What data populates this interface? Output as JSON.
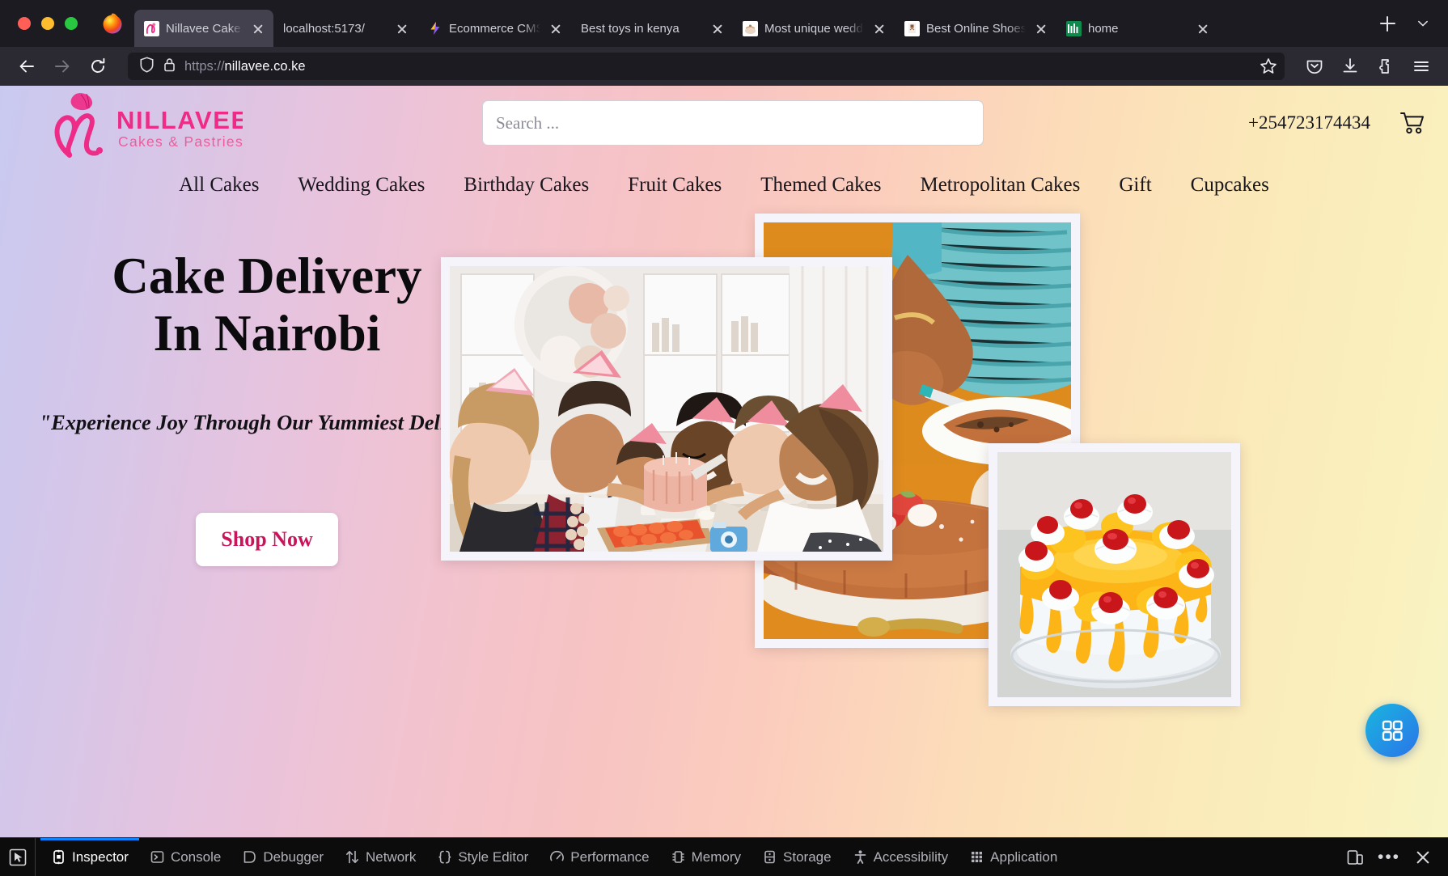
{
  "browser": {
    "window_controls": [
      "close",
      "minimize",
      "maximize"
    ],
    "app_icon": "firefox-icon",
    "tabs": [
      {
        "title": "Nillavee Cake Shop",
        "favicon": "nillavee-logo-icon",
        "active": true
      },
      {
        "title": "localhost:5173/",
        "favicon": "",
        "active": false
      },
      {
        "title": "Ecommerce CMS",
        "favicon": "lightning-icon",
        "active": false
      },
      {
        "title": "Best toys in kenya",
        "favicon": "",
        "active": false
      },
      {
        "title": "Most unique wedding cakes",
        "favicon": "cake-thumb-icon",
        "active": false
      },
      {
        "title": "Best Online Shoes",
        "favicon": "shoe-thumb-icon",
        "active": false
      },
      {
        "title": "home",
        "favicon": "green-sheet-icon",
        "active": false
      }
    ],
    "new_tab_label": "+",
    "list_all_tabs_label": "List all tabs",
    "back_label": "Go back",
    "forward_label": "Go forward",
    "reload_label": "Reload",
    "url_scheme": "https://",
    "url_host": "nillavee.co.ke",
    "bookmark_label": "Bookmark this page",
    "toolbar_right": [
      "pocket-icon",
      "downloads-icon",
      "extensions-icon",
      "app-menu-icon"
    ]
  },
  "site": {
    "logo": {
      "brand": "NILLAVEE",
      "tagline": "Cakes & Pastries",
      "monogram": "N",
      "color": "#ed1e79"
    },
    "search": {
      "value": "",
      "placeholder": "Search ..."
    },
    "contact": {
      "phone": "+254723174434"
    },
    "cart": {
      "icon": "shopping-cart-icon",
      "count": ""
    },
    "nav": [
      {
        "label": "All Cakes"
      },
      {
        "label": "Wedding Cakes"
      },
      {
        "label": "Birthday Cakes"
      },
      {
        "label": "Fruit Cakes"
      },
      {
        "label": "Themed Cakes"
      },
      {
        "label": "Metropolitan Cakes"
      },
      {
        "label": "Gift"
      },
      {
        "label": "Cupcakes"
      }
    ],
    "hero": {
      "title": "Cake Delivery In Nairobi",
      "subtitle": "\"Experience Joy Through Our Yummiest Delights\"",
      "cta_label": "Shop Now",
      "cta_text_color": "#c9145b",
      "images": [
        {
          "name": "birthday-party-cake-photo",
          "alt": "Friends in party hats cutting a pink birthday cake"
        },
        {
          "name": "chocolate-cake-serving-photo",
          "alt": "Woman slicing a chocolate mousse cake on an orange background"
        },
        {
          "name": "mango-cream-cake-photo",
          "alt": "Mango glazed cake with cherries and cream swirls"
        }
      ]
    },
    "fab": {
      "icon": "apps-grid-icon",
      "label": "Open widget panel",
      "color_from": "#19b6e0",
      "color_to": "#2b74e8"
    },
    "background_gradient": [
      "#c9c9f0",
      "#f2c3cf",
      "#fbcdbd",
      "#faf0bd"
    ]
  },
  "devtools": {
    "picker_icon": "element-picker-icon",
    "tabs": [
      {
        "label": "Inspector",
        "icon": "inspector-icon",
        "active": true
      },
      {
        "label": "Console",
        "icon": "console-icon",
        "active": false
      },
      {
        "label": "Debugger",
        "icon": "debugger-icon",
        "active": false
      },
      {
        "label": "Network",
        "icon": "network-icon",
        "active": false
      },
      {
        "label": "Style Editor",
        "icon": "style-editor-icon",
        "active": false
      },
      {
        "label": "Performance",
        "icon": "performance-icon",
        "active": false
      },
      {
        "label": "Memory",
        "icon": "memory-icon",
        "active": false
      },
      {
        "label": "Storage",
        "icon": "storage-icon",
        "active": false
      },
      {
        "label": "Accessibility",
        "icon": "accessibility-icon",
        "active": false
      },
      {
        "label": "Application",
        "icon": "application-icon",
        "active": false
      }
    ],
    "active_tab_accent": "#0a84ff",
    "right_buttons": [
      {
        "icon": "responsive-design-mode-icon",
        "label": "Responsive Design Mode"
      },
      {
        "icon": "meatball-menu-icon",
        "label": "Customise DevTools"
      },
      {
        "icon": "close-icon",
        "label": "Close DevTools"
      }
    ]
  }
}
